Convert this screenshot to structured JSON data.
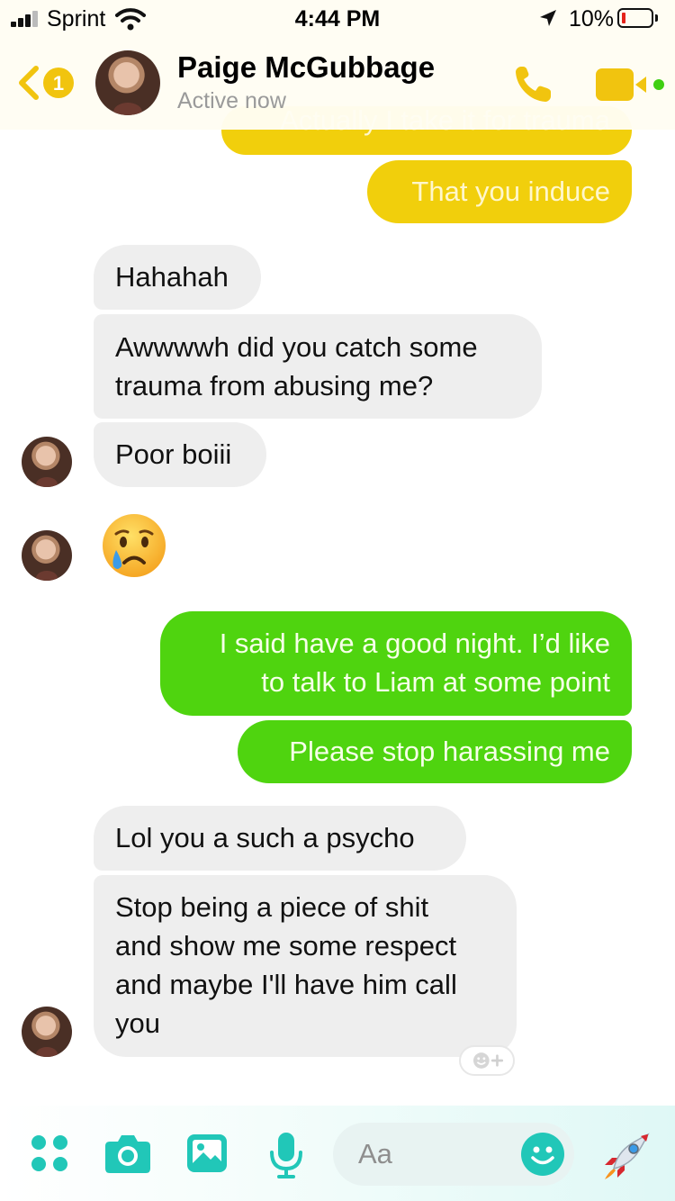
{
  "status_bar": {
    "carrier": "Sprint",
    "time": "4:44 PM",
    "battery": "10%"
  },
  "header": {
    "unread_count": "1",
    "contact_name": "Paige McGubbage",
    "presence": "Active now"
  },
  "messages": [
    {
      "from": "me",
      "text": "Actually I take it for trauma",
      "partially_hidden": true
    },
    {
      "from": "me",
      "text": "That you induce"
    },
    {
      "from": "them",
      "text": "Hahahah"
    },
    {
      "from": "them",
      "lines": [
        "Awwwwh did you catch some",
        "trauma from abusing me?"
      ]
    },
    {
      "from": "them",
      "text": "Poor boiii"
    },
    {
      "from": "them",
      "emoji": "crying-face"
    },
    {
      "from": "me",
      "lines": [
        "I said have a good night. I’d like",
        "to talk to Liam at some point"
      ]
    },
    {
      "from": "me",
      "text": "Please stop harassing me"
    },
    {
      "from": "them",
      "text": "Lol you a such a psycho"
    },
    {
      "from": "them",
      "lines": [
        "Stop being a piece of shit",
        "and show me some respect",
        "and maybe I'll have him call",
        "you"
      ]
    }
  ],
  "composer": {
    "placeholder": "Aa"
  },
  "colors": {
    "accent": "#f1cf0c",
    "sent_green": "#4fd40f",
    "composer_teal": "#21c7b8",
    "received": "#eeeeee"
  }
}
